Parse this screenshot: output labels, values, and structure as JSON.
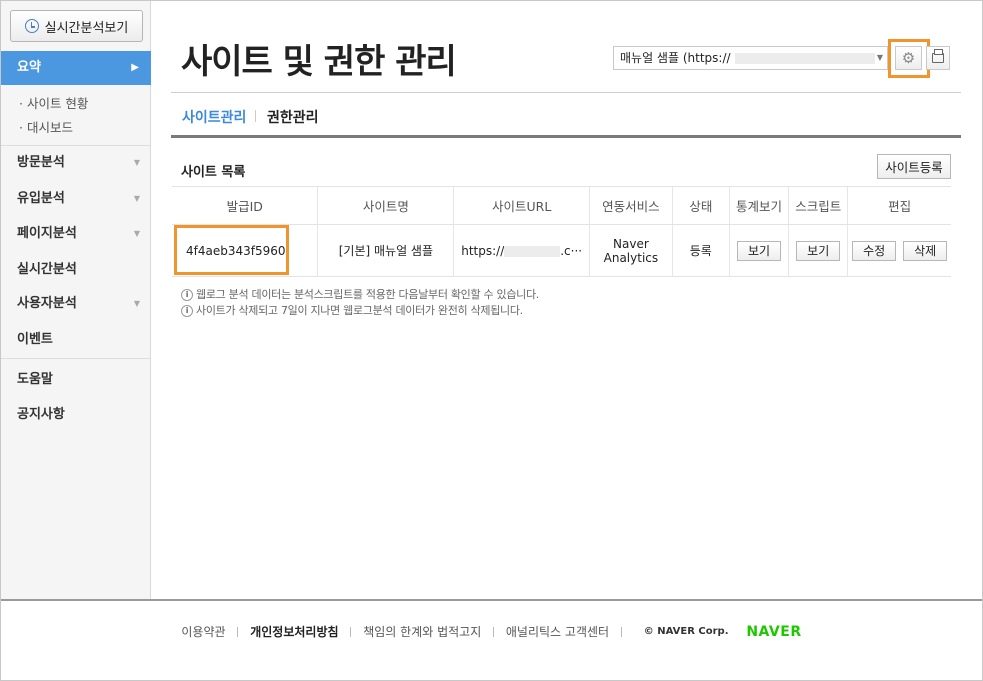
{
  "sidebar": {
    "realtime_button": "실시간분석보기",
    "active_item": "요약",
    "sub_items": [
      "· 사이트 현황",
      "· 대시보드"
    ],
    "items": [
      "방문분석",
      "유입분석",
      "페이지분석",
      "실시간분석",
      "사용자분석",
      "이벤트",
      "도움말",
      "공지사항"
    ]
  },
  "header": {
    "title": "사이트 및 권한 관리",
    "site_select_value": "매뉴얼 샘플 (https://"
  },
  "tabs": {
    "site_manage": "사이트관리",
    "permission_manage": "권한관리"
  },
  "section": {
    "title": "사이트 목록",
    "register_button": "사이트등록"
  },
  "table": {
    "headers": [
      "발급ID",
      "사이트명",
      "사이트URL",
      "연동서비스",
      "상태",
      "통계보기",
      "스크립트",
      "편집"
    ],
    "row": {
      "id": "4f4aeb343f5960",
      "name": "[기본] 매뉴얼 샘플",
      "url_prefix": "https://",
      "url_suffix": ".c···",
      "service_line1": "Naver",
      "service_line2": "Analytics",
      "status": "등록",
      "stats_button": "보기",
      "script_button": "보기",
      "edit_button": "수정",
      "delete_button": "삭제"
    }
  },
  "notes": [
    "웹로그 분석 데이터는 분석스크립트를 적용한 다음날부터 확인할 수 있습니다.",
    "사이트가 삭제되고 7일이 지나면 웹로그분석 데이터가 완전히 삭제됩니다."
  ],
  "footer": {
    "terms": "이용약관",
    "privacy": "개인정보처리방침",
    "disclaimer": "책임의 한계와 법적고지",
    "support": "애널리틱스 고객센터",
    "copyright": "© NAVER Corp.",
    "brand": "NAVER"
  },
  "colors": {
    "accent": "#4c98e0",
    "highlight": "#f0952e",
    "naver_green": "#1ec800"
  }
}
